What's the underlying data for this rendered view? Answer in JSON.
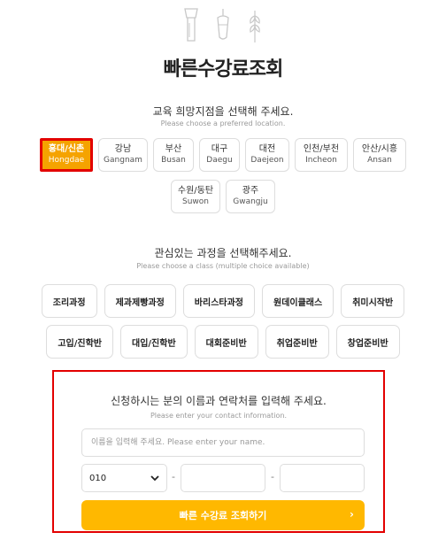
{
  "title": "빠른수강료조회",
  "location_section": {
    "title": "교육 희망지점을 선택해 주세요.",
    "subtitle": "Please choose a preferred location.",
    "row1": [
      {
        "ko": "홍대/신촌",
        "en": "Hongdae",
        "selected": true
      },
      {
        "ko": "강남",
        "en": "Gangnam"
      },
      {
        "ko": "부산",
        "en": "Busan"
      },
      {
        "ko": "대구",
        "en": "Daegu"
      },
      {
        "ko": "대전",
        "en": "Daejeon"
      },
      {
        "ko": "인천/부천",
        "en": "Incheon"
      },
      {
        "ko": "안산/시흥",
        "en": "Ansan"
      }
    ],
    "row2": [
      {
        "ko": "수원/동탄",
        "en": "Suwon"
      },
      {
        "ko": "광주",
        "en": "Gwangju"
      }
    ]
  },
  "class_section": {
    "title": "관심있는 과정을 선택해주세요.",
    "subtitle": "Please choose a class (multiple choice available)",
    "row1": [
      "조리과정",
      "제과제빵과정",
      "바리스타과정",
      "원데이클래스",
      "취미시작반"
    ],
    "row2": [
      "고입/진학반",
      "대입/진학반",
      "대회준비반",
      "취업준비반",
      "창업준비반"
    ]
  },
  "contact_section": {
    "title": "신청하시는 분의 이름과 연락처를 입력해 주세요.",
    "subtitle": "Please enter your contact information.",
    "name_placeholder": "이름을 입력해 주세요. Please enter your name.",
    "phone_prefix": "010",
    "dash": "-",
    "submit_label": "빠른 수강료 조회하기",
    "submit_arrow": "›"
  },
  "colors": {
    "accent": "#ffb800",
    "selected": "#f5a300",
    "highlight_border": "#e30000"
  }
}
